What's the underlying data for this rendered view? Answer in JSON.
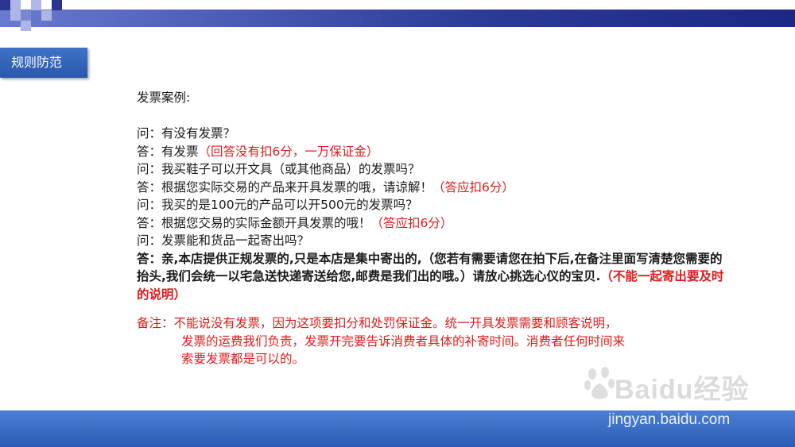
{
  "header": {
    "title": "规则防范"
  },
  "content": {
    "intro": "发票案例:",
    "qa": [
      {
        "prefix": "问：",
        "text": "有没有发票？",
        "note": ""
      },
      {
        "prefix": "答：",
        "text": "有发票",
        "note": "（回答没有扣6分，一万保证金）"
      },
      {
        "prefix": "问：",
        "text": "我买鞋子可以开文具（或其他商品）的发票吗？",
        "note": ""
      },
      {
        "prefix": "答：",
        "text": "根据您实际交易的产品来开具发票的哦，请谅解！",
        "note": "（答应扣6分）"
      },
      {
        "prefix": "问：",
        "text": "我买的是100元的产品可以开500元的发票吗？",
        "note": ""
      },
      {
        "prefix": "答：",
        "text": "根据您交易的实际金额开具发票的哦！",
        "note": "（答应扣6分）"
      },
      {
        "prefix": "问：",
        "text": "发票能和货品一起寄出吗？",
        "note": ""
      }
    ],
    "last_answer": {
      "text": "答：亲,本店提供正规发票的,只是本店是集中寄出的,（您若有需要请您在拍下后,在备注里面写清楚您需要的抬头,我们会统一以宅急送快递寄送给您,邮费是我们出的哦。）请放心挑选心仪的宝贝.",
      "note": "（不能一起寄出要及时的说明）"
    },
    "remark": {
      "line1": "备注：不能说没有发票，因为这项要扣分和处罚保证金。统一开具发票需要和顾客说明，",
      "line2": "发票的运费我们负责，发票开完要告诉消费者具体的补寄时间。消费者任何时间来",
      "line3": "索要发票都是可以的。"
    }
  },
  "watermark": {
    "brand": "Baidu经验",
    "url": "jingyan.baidu.com"
  },
  "colors": {
    "accent_red": "#e01b1b",
    "tab_blue": "#3f72c6",
    "top_bar": "#2c3a98",
    "bottom_bar": "#3a6cc6"
  }
}
